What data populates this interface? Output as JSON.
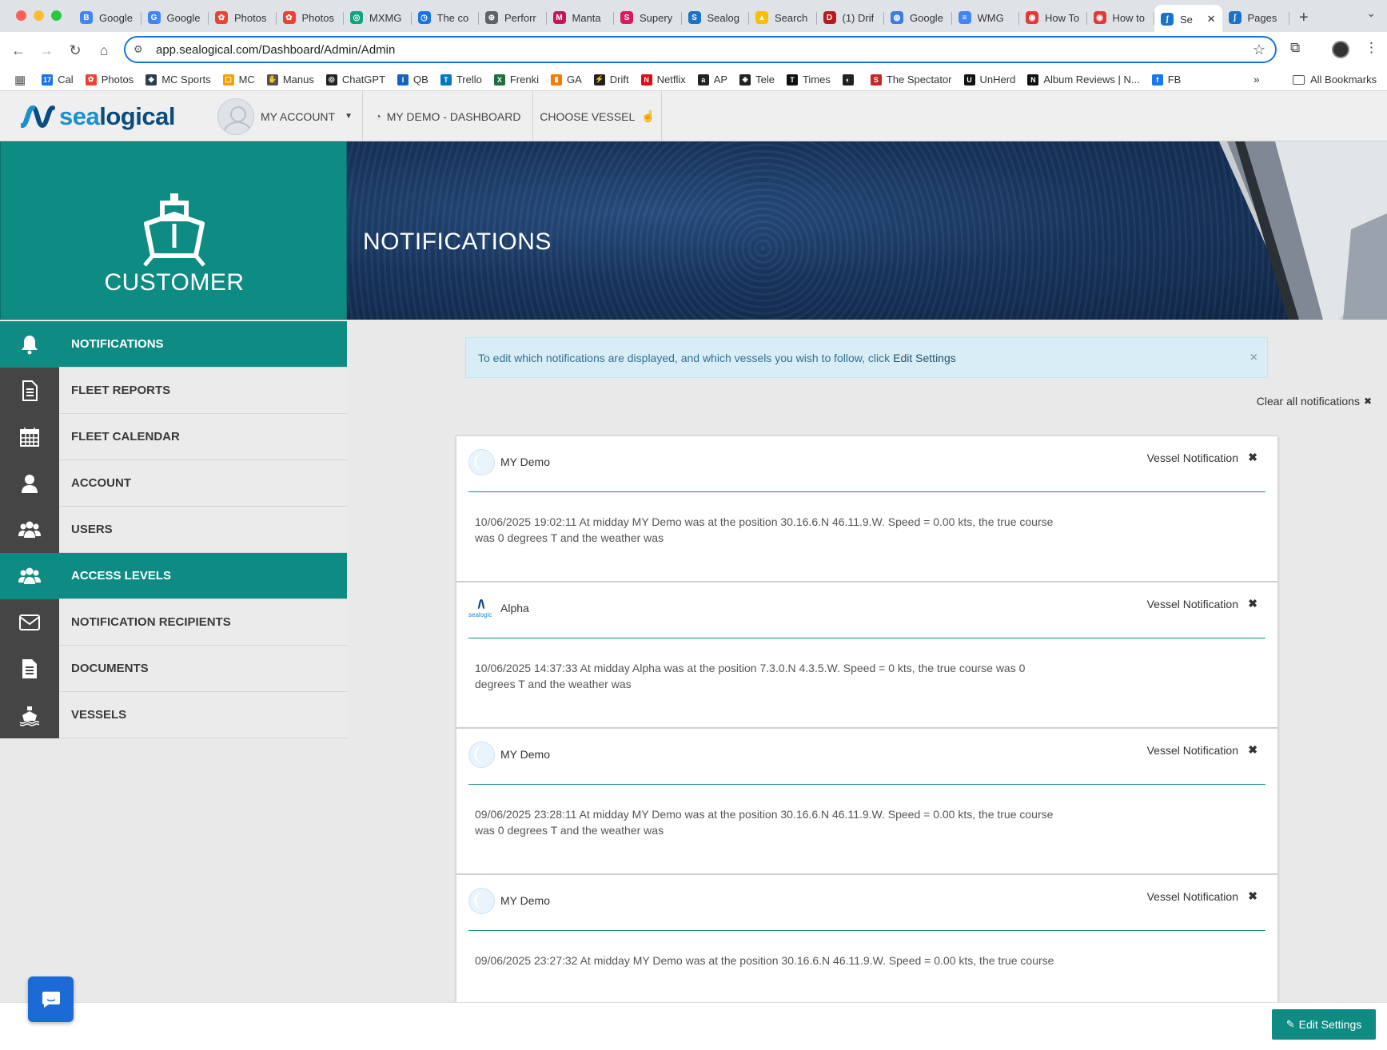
{
  "browser": {
    "tabs": [
      {
        "label": "Google",
        "color": "#4285f4",
        "glyph": "B"
      },
      {
        "label": "Google",
        "color": "#4285f4",
        "glyph": "G"
      },
      {
        "label": "Photos",
        "color": "#ea4335",
        "glyph": "✿"
      },
      {
        "label": "Photos",
        "color": "#ea4335",
        "glyph": "✿"
      },
      {
        "label": "MXMG",
        "color": "#10a37f",
        "glyph": "◎"
      },
      {
        "label": "The co",
        "color": "#1a73e8",
        "glyph": "◷"
      },
      {
        "label": "Perforr",
        "color": "#5f6368",
        "glyph": "⊕"
      },
      {
        "label": "Manta",
        "color": "#c2185b",
        "glyph": "M"
      },
      {
        "label": "Supery",
        "color": "#d81b60",
        "glyph": "S"
      },
      {
        "label": "Sealog",
        "color": "#1b73c7",
        "glyph": "S"
      },
      {
        "label": "Search",
        "color": "#fbbc04",
        "glyph": "▲"
      },
      {
        "label": "(1) Drif",
        "color": "#b71c1c",
        "glyph": "D"
      },
      {
        "label": "Google",
        "color": "#3c7be0",
        "glyph": "◍"
      },
      {
        "label": "WMG",
        "color": "#4285f4",
        "glyph": "≡"
      },
      {
        "label": "How To",
        "color": "#e53935",
        "glyph": "◉"
      },
      {
        "label": "How to",
        "color": "#e53935",
        "glyph": "◉"
      },
      {
        "label": "Se",
        "color": "#1b73c7",
        "glyph": "ʃ",
        "active": true
      },
      {
        "label": "Pages",
        "color": "#1b73c7",
        "glyph": "ʃ"
      }
    ],
    "url": "app.sealogical.com/Dashboard/Admin/Admin",
    "bookmarks": [
      {
        "label": "Cal",
        "color": "#1a73e8",
        "glyph": "17"
      },
      {
        "label": "Photos",
        "color": "#ea4335",
        "glyph": "✿"
      },
      {
        "label": "MC Sports",
        "color": "#2c3e50",
        "glyph": "◆"
      },
      {
        "label": "MC",
        "color": "#f4a100",
        "glyph": "▢"
      },
      {
        "label": "Manus",
        "color": "#555555",
        "glyph": "✋"
      },
      {
        "label": "ChatGPT",
        "color": "#222222",
        "glyph": "◎"
      },
      {
        "label": "QB",
        "color": "#1565c0",
        "glyph": "I"
      },
      {
        "label": "Trello",
        "color": "#0079bf",
        "glyph": "T"
      },
      {
        "label": "Frenki",
        "color": "#1d6f42",
        "glyph": "X"
      },
      {
        "label": "GA",
        "color": "#f57c00",
        "glyph": "▮"
      },
      {
        "label": "Drift",
        "color": "#222222",
        "glyph": "⚡"
      },
      {
        "label": "Netflix",
        "color": "#e50914",
        "glyph": "N"
      },
      {
        "label": "AP",
        "color": "#222222",
        "glyph": "a"
      },
      {
        "label": "Tele",
        "color": "#222222",
        "glyph": "◈"
      },
      {
        "label": "Times",
        "color": "#111111",
        "glyph": "T"
      },
      {
        "label": "",
        "color": "#222222",
        "glyph": "◐"
      },
      {
        "label": "The Spectator",
        "color": "#c62828",
        "glyph": "S"
      },
      {
        "label": "UnHerd",
        "color": "#111111",
        "glyph": "U"
      },
      {
        "label": "Album Reviews | N...",
        "color": "#111111",
        "glyph": "N"
      },
      {
        "label": "FB",
        "color": "#1877f2",
        "glyph": "f"
      }
    ],
    "all_bookmarks": "All Bookmarks"
  },
  "header": {
    "brand_prefix": "sea",
    "brand_suffix": "logical",
    "account_label": "MY ACCOUNT",
    "dashboard_label": "MY DEMO - DASHBOARD",
    "choose_vessel_label": "CHOOSE VESSEL"
  },
  "sidebar": {
    "title": "CUSTOMER",
    "items": [
      {
        "label": "NOTIFICATIONS",
        "icon": "bell-icon",
        "active": true
      },
      {
        "label": "FLEET REPORTS",
        "icon": "file-text-icon"
      },
      {
        "label": "FLEET CALENDAR",
        "icon": "calendar-icon"
      },
      {
        "label": "ACCOUNT",
        "icon": "user-icon"
      },
      {
        "label": "USERS",
        "icon": "users-icon"
      },
      {
        "label": "ACCESS LEVELS",
        "icon": "users-icon",
        "active": true,
        "arrow": true
      },
      {
        "label": "NOTIFICATION RECIPIENTS",
        "icon": "envelope-icon"
      },
      {
        "label": "DOCUMENTS",
        "icon": "document-icon"
      },
      {
        "label": "VESSELS",
        "icon": "ship-icon"
      }
    ]
  },
  "hero": {
    "title": "NOTIFICATIONS"
  },
  "alert": {
    "text": "To edit which notifications are displayed, and which vessels you wish to follow, click",
    "link": "Edit Settings",
    "close": "×"
  },
  "clear_all": "Clear all notifications",
  "notifications": [
    {
      "vessel": "MY Demo",
      "type": "Vessel Notification",
      "icon": "globe-icon",
      "text": "10/06/2025 19:02:11 At midday MY Demo was at the position 30.16.6.N 46.11.9.W. Speed = 0.00 kts, the true course was 0 degrees T and the weather was"
    },
    {
      "vessel": "Alpha",
      "type": "Vessel Notification",
      "icon": "sealogical-logo-icon",
      "text": "10/06/2025 14:37:33 At midday Alpha was at the position 7.3.0.N 4.3.5.W. Speed = 0 kts, the true course was 0 degrees T and the weather was"
    },
    {
      "vessel": "MY Demo",
      "type": "Vessel Notification",
      "icon": "globe-icon",
      "text": "09/06/2025 23:28:11 At midday MY Demo was at the position 30.16.6.N 46.11.9.W. Speed = 0.00 kts, the true course was 0 degrees T and the weather was"
    },
    {
      "vessel": "MY Demo",
      "type": "Vessel Notification",
      "icon": "globe-icon",
      "text": "09/06/2025 23:27:32 At midday MY Demo was at the position 30.16.6.N 46.11.9.W. Speed = 0.00 kts, the true course"
    }
  ],
  "footer": {
    "edit_settings": "Edit Settings"
  },
  "colors": {
    "teal": "#0e8b83",
    "dark_icon_bg": "#454545",
    "alert_bg": "#d9edf7",
    "alert_text": "#31708f",
    "chat_blue": "#1c6ad6"
  }
}
